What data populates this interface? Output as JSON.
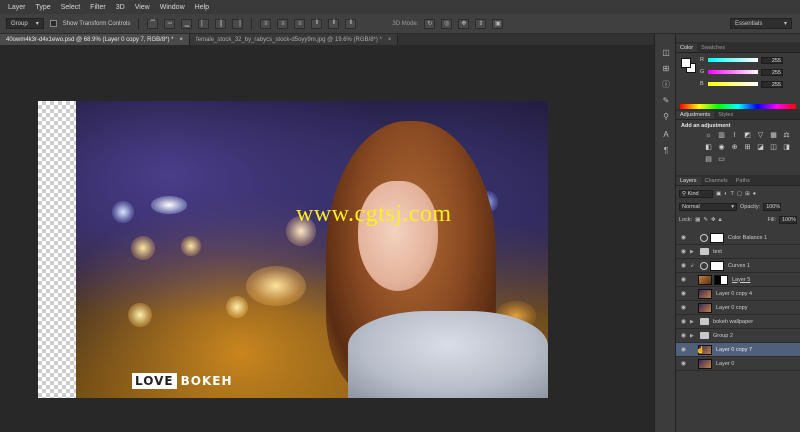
{
  "menu": [
    "Layer",
    "Type",
    "Select",
    "Filter",
    "3D",
    "View",
    "Window",
    "Help"
  ],
  "options": {
    "auto_select_value": "Group",
    "transform_label": "Show Transform Controls",
    "mode_label": "3D Mode:",
    "workspace": "Essentials"
  },
  "tabs": [
    {
      "label": "40owm4k3r-d4x1ewo.psd @ 68.9% (Layer 0 copy 7, RGB/8*) *",
      "state": "active"
    },
    {
      "label": "female_stock_32_by_rabycs_stock-d5oyy9m.jpg @ 19.6% (RGB/8*) *",
      "state": "inactive"
    }
  ],
  "canvas": {
    "watermark": "www.cgtsj.com",
    "logo_box": "LOVE",
    "logo_text": "BOKEH"
  },
  "color_panel": {
    "tabs": [
      "Color",
      "Swatches"
    ],
    "r_label": "R",
    "r_value": "255",
    "g_label": "G",
    "g_value": "255",
    "b_label": "B",
    "b_value": "255"
  },
  "adjustments_panel": {
    "tabs": [
      "Adjustments",
      "Styles"
    ],
    "title": "Add an adjustment"
  },
  "layers_panel": {
    "tabs": [
      "Layers",
      "Channels",
      "Paths"
    ],
    "kind": "Kind",
    "blend_mode": "Normal",
    "opacity_label": "Opacity:",
    "opacity_value": "100%",
    "lock_label": "Lock:",
    "fill_label": "Fill:",
    "fill_value": "100%",
    "layers": [
      {
        "name": "Color Balance 1",
        "kind": "adjustment"
      },
      {
        "name": "text",
        "kind": "folder"
      },
      {
        "name": "Curves 1",
        "kind": "adjustment"
      },
      {
        "name": "Layer 5",
        "kind": "masked"
      },
      {
        "name": "Layer 0 copy 4",
        "kind": "pixel"
      },
      {
        "name": "Layer 0 copy",
        "kind": "pixel"
      },
      {
        "name": "bokeh wallpaper",
        "kind": "folder"
      },
      {
        "name": "Group 2",
        "kind": "folder"
      },
      {
        "name": "Layer 0 copy 7",
        "kind": "pixel",
        "selected": true
      },
      {
        "name": "Layer 0",
        "kind": "pixel"
      }
    ]
  },
  "colors": {
    "selection": "#51607a",
    "watermark": "#ffef1a"
  }
}
